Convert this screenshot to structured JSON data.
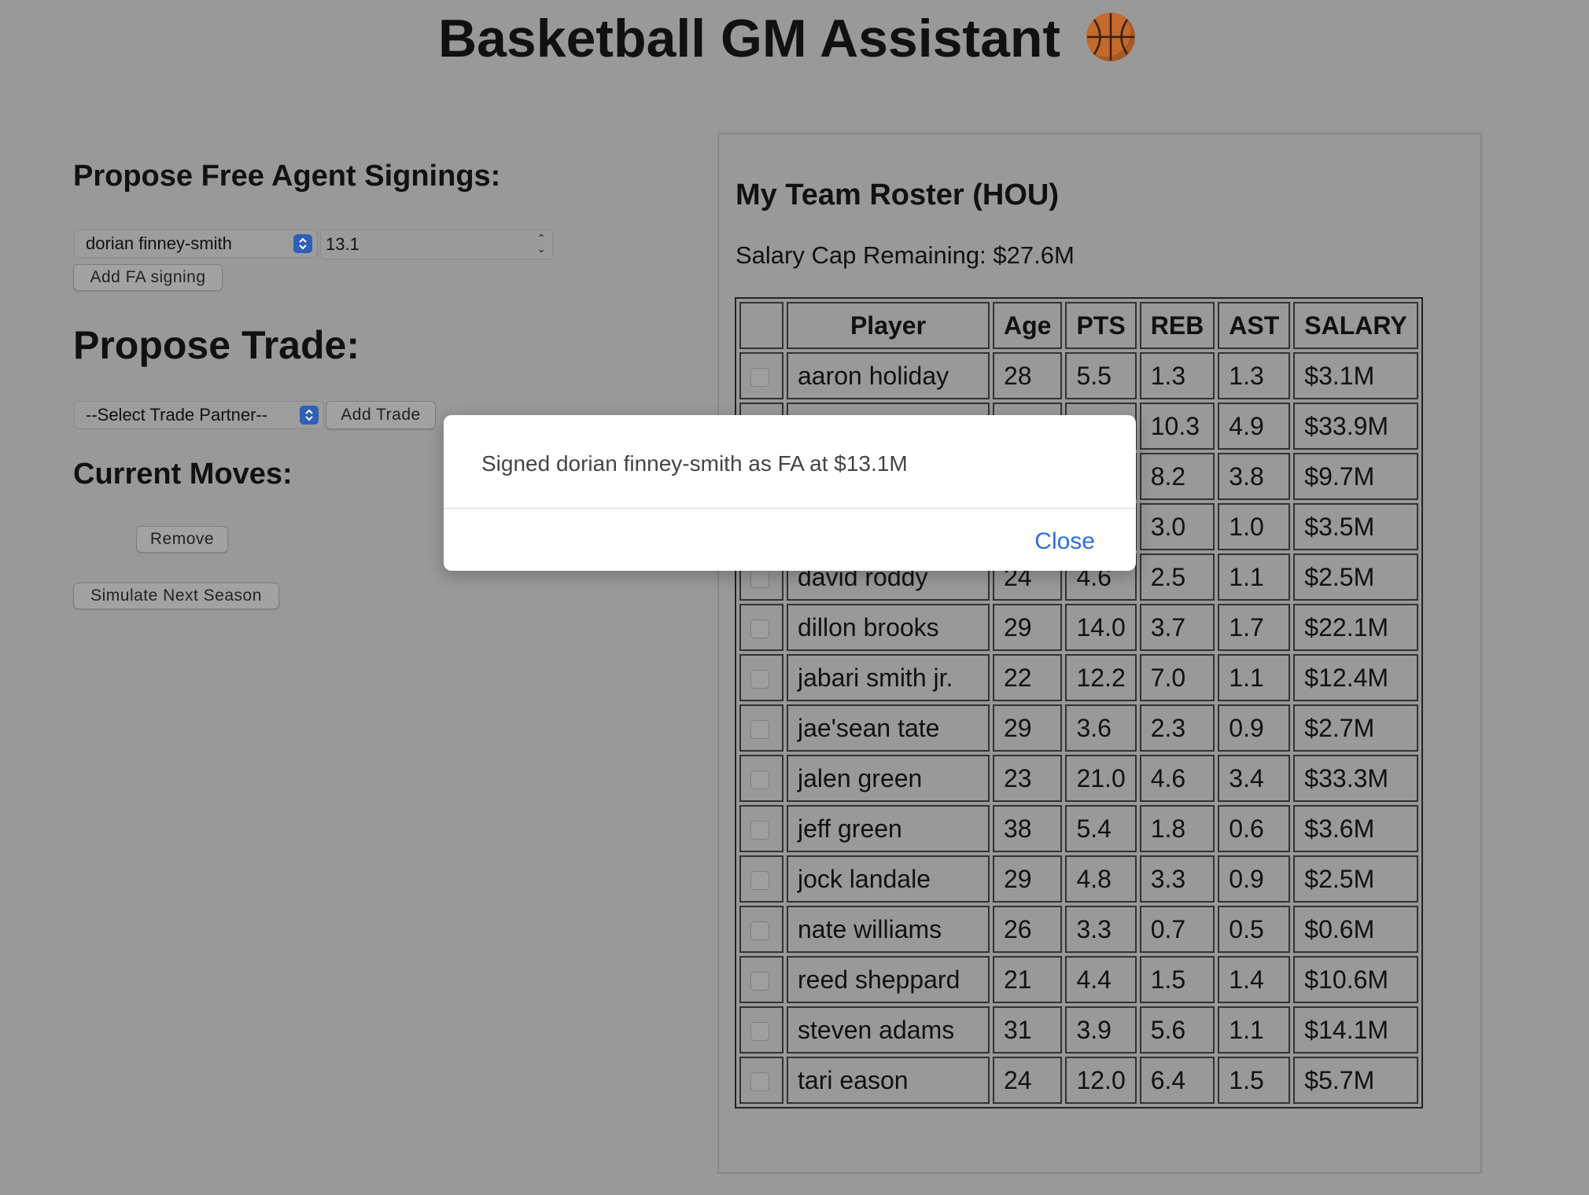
{
  "app": {
    "title": "Basketball GM Assistant"
  },
  "free_agent": {
    "heading": "Propose Free Agent Signings:",
    "selected_player": "dorian finney-smith",
    "amount": "13.1",
    "add_button": "Add FA signing"
  },
  "trade": {
    "heading": "Propose Trade:",
    "partner_selected": "--Select Trade Partner--",
    "add_button": "Add Trade"
  },
  "moves": {
    "heading": "Current Moves:",
    "remove_button": "Remove",
    "simulate_button": "Simulate Next Season"
  },
  "roster": {
    "title": "My Team Roster (HOU)",
    "cap_text": "Salary Cap Remaining: $27.6M",
    "columns": [
      "",
      "Player",
      "Age",
      "PTS",
      "REB",
      "AST",
      "SALARY"
    ],
    "rows": [
      [
        "aaron holiday",
        "28",
        "5.5",
        "1.3",
        "1.3",
        "$3.1M"
      ],
      [
        "",
        "",
        "",
        "10.3",
        "4.9",
        "$33.9M"
      ],
      [
        "",
        "",
        "",
        "8.2",
        "3.8",
        "$9.7M"
      ],
      [
        "",
        "",
        "",
        "3.0",
        "1.0",
        "$3.5M"
      ],
      [
        "david roddy",
        "24",
        "4.6",
        "2.5",
        "1.1",
        "$2.5M"
      ],
      [
        "dillon brooks",
        "29",
        "14.0",
        "3.7",
        "1.7",
        "$22.1M"
      ],
      [
        "jabari smith jr.",
        "22",
        "12.2",
        "7.0",
        "1.1",
        "$12.4M"
      ],
      [
        "jae'sean tate",
        "29",
        "3.6",
        "2.3",
        "0.9",
        "$2.7M"
      ],
      [
        "jalen green",
        "23",
        "21.0",
        "4.6",
        "3.4",
        "$33.3M"
      ],
      [
        "jeff green",
        "38",
        "5.4",
        "1.8",
        "0.6",
        "$3.6M"
      ],
      [
        "jock landale",
        "29",
        "4.8",
        "3.3",
        "0.9",
        "$2.5M"
      ],
      [
        "nate williams",
        "26",
        "3.3",
        "0.7",
        "0.5",
        "$0.6M"
      ],
      [
        "reed sheppard",
        "21",
        "4.4",
        "1.5",
        "1.4",
        "$10.6M"
      ],
      [
        "steven adams",
        "31",
        "3.9",
        "5.6",
        "1.1",
        "$14.1M"
      ],
      [
        "tari eason",
        "24",
        "12.0",
        "6.4",
        "1.5",
        "$5.7M"
      ]
    ]
  },
  "dialog": {
    "message": "Signed dorian finney-smith as FA at $13.1M",
    "close_label": "Close"
  },
  "colors": {
    "page_bg": "#999999",
    "accent_blue": "#2d6fd8",
    "select_caret": "#2f5fb6",
    "ball": "#c46a2d"
  },
  "icons": {
    "title_icon": "basketball-icon"
  }
}
